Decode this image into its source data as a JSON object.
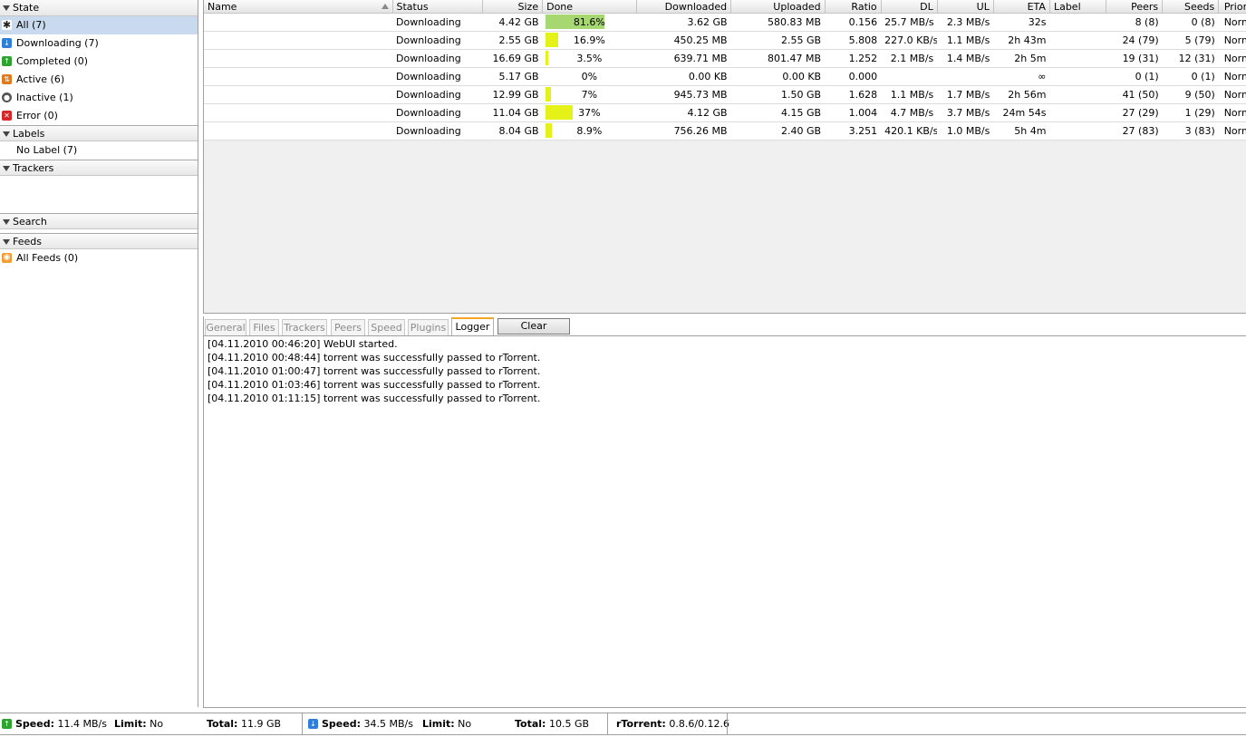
{
  "sidebar": {
    "state_header": "State",
    "state_items": [
      {
        "label": "All (7)",
        "icon": "all-icon",
        "color": "#333333"
      },
      {
        "label": "Downloading (7)",
        "icon": "download-icon",
        "color": "#2f7fd8"
      },
      {
        "label": "Completed (0)",
        "icon": "completed-icon",
        "color": "#2ea32e"
      },
      {
        "label": "Active (6)",
        "icon": "active-icon",
        "color": "#e07b1a"
      },
      {
        "label": "Inactive (1)",
        "icon": "inactive-icon",
        "color": "#555555"
      },
      {
        "label": "Error (0)",
        "icon": "error-icon",
        "color": "#d62828"
      }
    ],
    "labels_header": "Labels",
    "labels_items": [
      "No Label (7)"
    ],
    "trackers_header": "Trackers",
    "search_header": "Search",
    "feeds_header": "Feeds",
    "feeds_items": [
      {
        "label": "All Feeds (0)",
        "icon": "rss-icon"
      }
    ]
  },
  "torrents": {
    "columns": [
      "Name",
      "Status",
      "Size",
      "Done",
      "Downloaded",
      "Uploaded",
      "Ratio",
      "DL",
      "UL",
      "ETA",
      "Label",
      "Peers",
      "Seeds",
      "Priority"
    ],
    "rows": [
      {
        "name": "",
        "status": "Downloading",
        "size": "4.42 GB",
        "done": "81.6%",
        "done_pct": 81.6,
        "bar_color": "#a6d771",
        "downloaded": "3.62 GB",
        "uploaded": "580.83 MB",
        "ratio": "0.156",
        "dl": "25.7 MB/s",
        "ul": "2.3 MB/s",
        "eta": "32s",
        "label": "",
        "peers": "8 (8)",
        "seeds": "0 (8)",
        "priority": "Normal"
      },
      {
        "name": "",
        "status": "Downloading",
        "size": "2.55 GB",
        "done": "16.9%",
        "done_pct": 16.9,
        "bar_color": "#e5f21a",
        "downloaded": "450.25 MB",
        "uploaded": "2.55 GB",
        "ratio": "5.808",
        "dl": "227.0 KB/s",
        "ul": "1.1 MB/s",
        "eta": "2h 43m",
        "label": "",
        "peers": "24 (79)",
        "seeds": "5 (79)",
        "priority": "Normal"
      },
      {
        "name": "",
        "status": "Downloading",
        "size": "16.69 GB",
        "done": "3.5%",
        "done_pct": 3.5,
        "bar_color": "#e5f21a",
        "downloaded": "639.71 MB",
        "uploaded": "801.47 MB",
        "ratio": "1.252",
        "dl": "2.1 MB/s",
        "ul": "1.4 MB/s",
        "eta": "2h 5m",
        "label": "",
        "peers": "19 (31)",
        "seeds": "12 (31)",
        "priority": "Normal"
      },
      {
        "name": "",
        "status": "Downloading",
        "size": "5.17 GB",
        "done": "0%",
        "done_pct": 0,
        "bar_color": "#e5f21a",
        "downloaded": "0.00 KB",
        "uploaded": "0.00 KB",
        "ratio": "0.000",
        "dl": "",
        "ul": "",
        "eta": "∞",
        "label": "",
        "peers": "0 (1)",
        "seeds": "0 (1)",
        "priority": "Normal"
      },
      {
        "name": "",
        "status": "Downloading",
        "size": "12.99 GB",
        "done": "7%",
        "done_pct": 7,
        "bar_color": "#e5f21a",
        "downloaded": "945.73 MB",
        "uploaded": "1.50 GB",
        "ratio": "1.628",
        "dl": "1.1 MB/s",
        "ul": "1.7 MB/s",
        "eta": "2h 56m",
        "label": "",
        "peers": "41 (50)",
        "seeds": "9 (50)",
        "priority": "Normal"
      },
      {
        "name": "",
        "status": "Downloading",
        "size": "11.04 GB",
        "done": "37%",
        "done_pct": 37,
        "bar_color": "#e5f21a",
        "downloaded": "4.12 GB",
        "uploaded": "4.15 GB",
        "ratio": "1.004",
        "dl": "4.7 MB/s",
        "ul": "3.7 MB/s",
        "eta": "24m 54s",
        "label": "",
        "peers": "27 (29)",
        "seeds": "1 (29)",
        "priority": "Normal"
      },
      {
        "name": "",
        "status": "Downloading",
        "size": "8.04 GB",
        "done": "8.9%",
        "done_pct": 8.9,
        "bar_color": "#e5f21a",
        "downloaded": "756.26 MB",
        "uploaded": "2.40 GB",
        "ratio": "3.251",
        "dl": "420.1 KB/s",
        "ul": "1.0 MB/s",
        "eta": "5h 4m",
        "label": "",
        "peers": "27 (83)",
        "seeds": "3 (83)",
        "priority": "Normal"
      }
    ]
  },
  "tabs": {
    "items": [
      "General",
      "Files",
      "Trackers",
      "Peers",
      "Speed",
      "Plugins",
      "Logger"
    ],
    "active": "Logger",
    "clear_label": "Clear"
  },
  "logger": {
    "lines": [
      "[04.11.2010 00:46:20] WebUI started.",
      "[04.11.2010 00:48:44] torrent was successfully passed to rTorrent.",
      "[04.11.2010 01:00:47] torrent was successfully passed to rTorrent.",
      "[04.11.2010 01:03:46] torrent was successfully passed to rTorrent.",
      "[04.11.2010 01:11:15] torrent was successfully passed to rTorrent."
    ]
  },
  "statusbar": {
    "up_speed_label": "Speed:",
    "up_speed": "11.4 MB/s",
    "up_limit_label": "Limit:",
    "up_limit": "No",
    "up_total_label": "Total:",
    "up_total": "11.9 GB",
    "down_speed_label": "Speed:",
    "down_speed": "34.5 MB/s",
    "down_limit_label": "Limit:",
    "down_limit": "No",
    "down_total_label": "Total:",
    "down_total": "10.5 GB",
    "rtorrent_label": "rTorrent:",
    "rtorrent_version": "0.8.6/0.12.6"
  },
  "colors": {
    "selected_bg": "#c9d9ee",
    "active_tab_accent": "#f5a623",
    "progress_full": "#a6d771",
    "progress_partial": "#e5f21a"
  }
}
